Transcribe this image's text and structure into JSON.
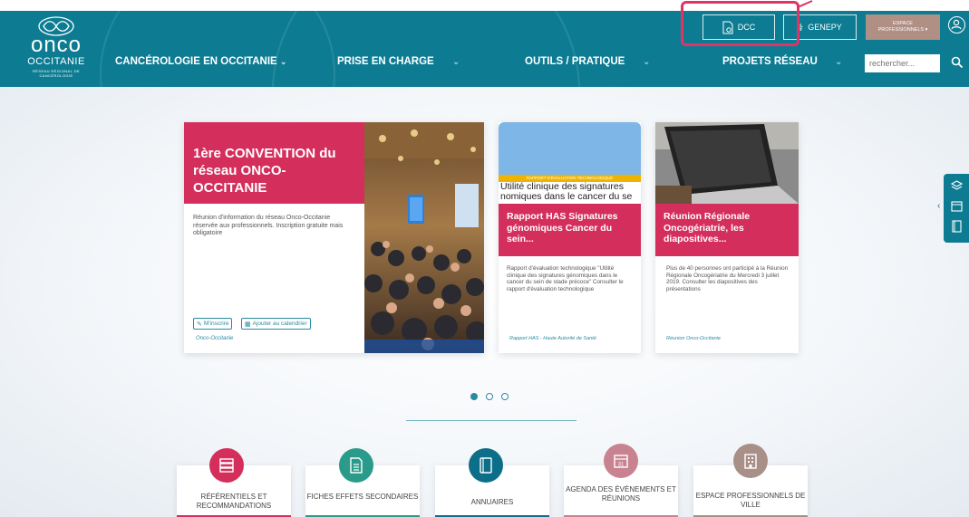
{
  "logo": {
    "line1": "onco",
    "line2": "OCCITANIE",
    "tagline": "RÉSEAU RÉGIONAL DE CANCÉROLOGIE"
  },
  "nav": [
    {
      "label": "CANCÉROLOGIE EN OCCITANIE"
    },
    {
      "label": "PRISE EN CHARGE"
    },
    {
      "label": "OUTILS / PRATIQUE"
    },
    {
      "label": "PROJETS RÉSEAU"
    }
  ],
  "top": {
    "dcc_label": "DCC",
    "genepy_label": "GENEPY",
    "espace_line1": "ESPACE",
    "espace_line2": "PROFESSIONNELS ▾"
  },
  "search": {
    "placeholder": "rechercher..."
  },
  "carousel": {
    "card1": {
      "title": "1ère CONVENTION du réseau ONCO-OCCITANIE",
      "text": "Réunion d'information du réseau Onco-Occitanie réservée aux professionnels. Inscription gratuite mais obligatoire",
      "btn_register": "M'inscrire",
      "btn_calendar": "Ajouter au calendrier",
      "meta": "Onco-Occitanie"
    },
    "card2": {
      "banner": "RAPPORT D'ÉVALUATION TECHNOLOGIQUE",
      "banner_title": "Utilité clinique des signatures nomiques dans le cancer du se",
      "title": "Rapport HAS Signatures génomiques Cancer du sein...",
      "text": "Rapport d'évaluation technologique \"Utilité clinique des signatures génomiques dans le cancer du sein de stade précoce\" Consulter le rapport d'évaluation technologique",
      "meta": "Rapport  HAS - Haute Autorité de Santé"
    },
    "card3": {
      "title": "Réunion Régionale Oncogériatrie, les diapositives...",
      "text": "Plus de 40 personnes ont participé à la Réunion Régionale Oncogériatrie du Mercredi 3 juillet 2019. Consulter les diapositives des présentations",
      "meta": "Réunion  Onco-Occitanie"
    },
    "dots": 3,
    "active_dot": 1
  },
  "quick": [
    {
      "label": "RÉFÉRENTIELS ET RECOMMANDATIONS",
      "color": "#d42f5c"
    },
    {
      "label": "FICHES EFFETS SECONDAIRES",
      "color": "#2a9b8a"
    },
    {
      "label": "ANNUAIRES",
      "color": "#0d6e8a"
    },
    {
      "label": "AGENDA DES ÉVÈNEMENTS ET RÉUNIONS",
      "color": "#c9828f",
      "calendar_day": "31"
    },
    {
      "label": "ESPACE PROFESSIONNELS DE VILLE",
      "color": "#a89088"
    }
  ],
  "colors": {
    "header": "#0d7c92",
    "accent": "#d42f5c",
    "highlight": "#e03368",
    "espace": "#b08f85"
  },
  "icons": [
    "infinity-logo-icon",
    "chevron-down-icon",
    "document-gear-icon",
    "dna-icon",
    "user-circle-icon",
    "search-icon",
    "calendar-icon",
    "edit-icon",
    "chevron-left-icon",
    "layers-icon",
    "book-icon",
    "building-icon",
    "document-icon"
  ]
}
